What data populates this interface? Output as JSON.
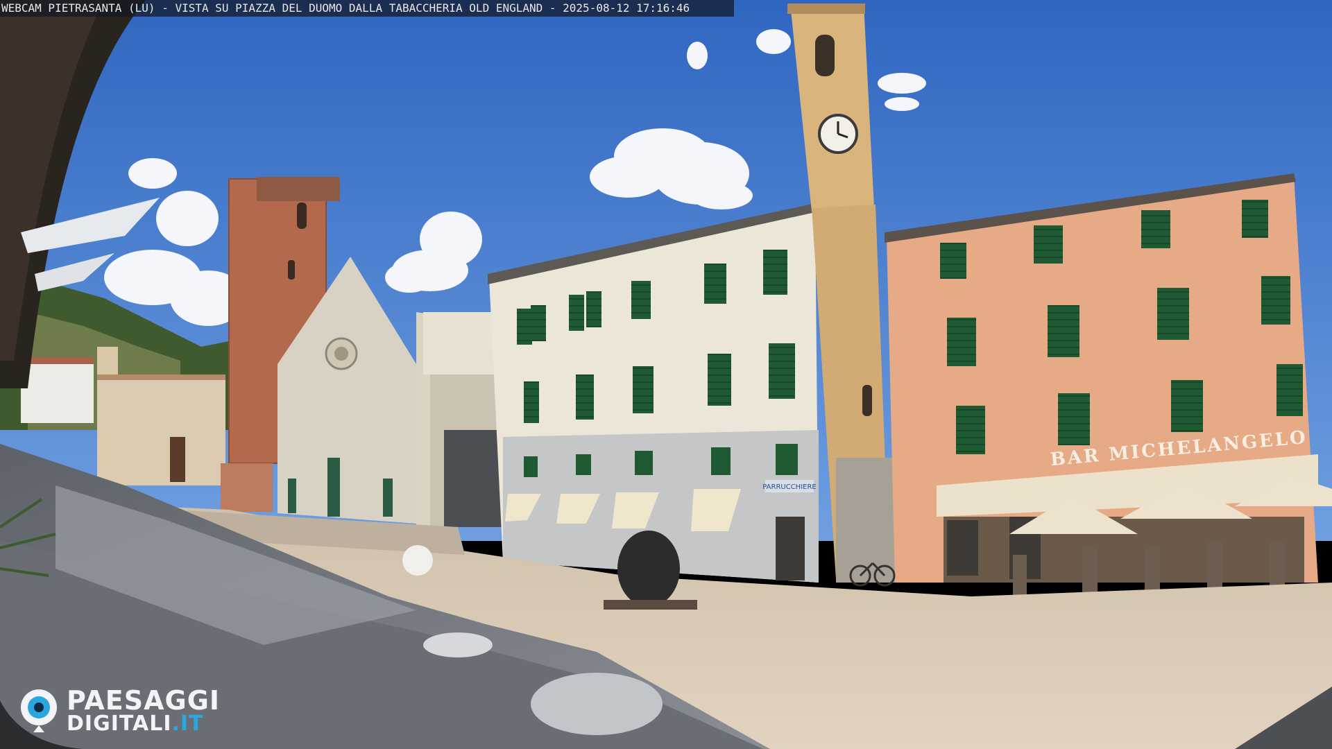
{
  "overlay": {
    "caption": "WEBCAM PIETRASANTA (LU) - VISTA SU PIAZZA DEL DUOMO DALLA TABACCHERIA OLD ENGLAND - 2025-08-12 17:16:46"
  },
  "logo": {
    "line1": "PAESAGGI",
    "line2_main": "DIGITALI",
    "line2_suffix": ".IT",
    "icon": "eye-logo-icon"
  },
  "scene": {
    "shop_sign": "BAR MICHELANGELO",
    "small_sign": "PARRUCCHIERE",
    "colors": {
      "sky": "#3f79c9",
      "white_building": "#ece6d8",
      "pink_building": "#e6ab86",
      "tower": "#d9b47c",
      "brick_tower": "#b36a4c",
      "cathedral": "#d8d2c4",
      "shutters": "#1f5a33",
      "pavement": "#d8c7b2",
      "umbrella": "#7d8188"
    }
  }
}
